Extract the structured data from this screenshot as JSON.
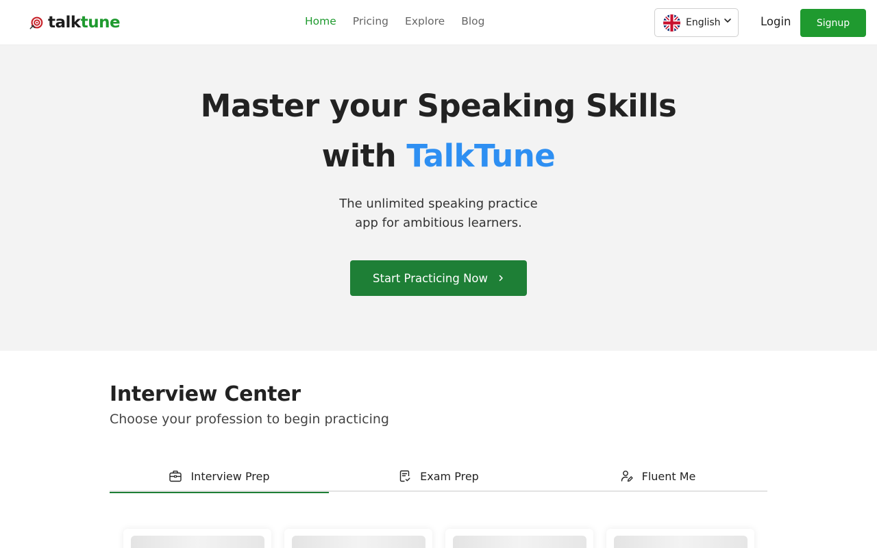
{
  "brand": {
    "name_part1": "talk",
    "name_part2": "tune",
    "accent_color": "#1f9a2f"
  },
  "nav": {
    "items": [
      {
        "label": "Home",
        "active": true
      },
      {
        "label": "Pricing",
        "active": false
      },
      {
        "label": "Explore",
        "active": false
      },
      {
        "label": "Blog",
        "active": false
      }
    ]
  },
  "language": {
    "selected": "English",
    "flag_icon": "uk-flag-icon"
  },
  "auth": {
    "login_label": "Login",
    "signup_label": "Signup"
  },
  "hero": {
    "title_line1": "Master your Speaking Skills",
    "title_line2_prefix": "with ",
    "title_line2_accent": "TalkTune",
    "accent_color": "#2e8ff2",
    "subtitle_line1": "The unlimited speaking practice",
    "subtitle_line2": "app for ambitious learners.",
    "cta_label": "Start Practicing Now",
    "cta_color": "#1e7f36"
  },
  "interview_center": {
    "title": "Interview Center",
    "subtitle": "Choose your profession to begin practicing",
    "tabs": [
      {
        "label": "Interview Prep",
        "icon": "briefcase-icon",
        "active": true
      },
      {
        "label": "Exam Prep",
        "icon": "exam-checklist-icon",
        "active": false
      },
      {
        "label": "Fluent Me",
        "icon": "user-edit-icon",
        "active": false
      }
    ],
    "card_count_visible": 4
  }
}
